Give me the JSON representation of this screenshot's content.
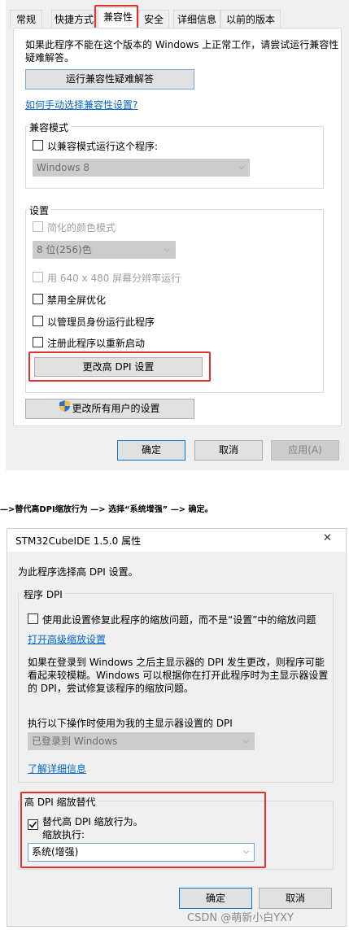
{
  "dialog1": {
    "tabs": [
      "常规",
      "快捷方式",
      "兼容性",
      "安全",
      "详细信息",
      "以前的版本"
    ],
    "intro": "如果此程序不能在这个版本的 Windows 上正常工作，请尝试运行兼容性疑难解答。",
    "intro_line1": "如果此程序不能在这个版本的 Windows 上正常工作，请尝试运行兼容性",
    "intro_line2": "疑难解答。",
    "troubleshooter_button": "运行兼容性疑难解答",
    "manual_link": "如何手动选择兼容性设置?",
    "compat_mode": {
      "group_label": "兼容模式",
      "checkbox_label": "以兼容模式运行这个程序:",
      "os_select": "Windows 8"
    },
    "settings": {
      "group_label": "设置",
      "reduced_color": "简化的颜色模式",
      "color_select": "8 位(256)色",
      "run_640": "用 640 x 480 屏幕分辨率运行",
      "disable_fullscreen": "禁用全屏优化",
      "run_as_admin": "以管理员身份运行此程序",
      "register_restart": "注册此程序以重新启动",
      "change_dpi_button": "更改高 DPI 设置"
    },
    "all_users_button": "更改所有用户的设置",
    "ok": "确定",
    "cancel": "取消",
    "apply": "应用(A)"
  },
  "instruction": "—>替代高DPI缩放行为 —> 选择“系统增强” —> 确定。",
  "dialog2": {
    "title": "STM32CubeIDE 1.5.0 属性",
    "close_glyph": "✕",
    "heading": "为此程序选择高 DPI 设置。",
    "program_dpi": {
      "group_label": "程序 DPI",
      "checkbox_label": "使用此设置修复此程序的缩放问题，而不是“设置”中的缩放问题",
      "advanced_link": "打开高级缩放设置",
      "desc_line1": "如果在登录到 Windows 之后主显示器的 DPI 发生更改，则程序可能",
      "desc_line2": "看起来较模糊。Windows 可以根据你在打开此程序时为主显示器设置",
      "desc_line3": "的 DPI，尝试修复该程序的缩放问题。",
      "when_label": "执行以下操作时使用为我的主显示器设置的 DPI",
      "when_select": "已登录到 Windows",
      "learn_more_link": "了解详细信息"
    },
    "override": {
      "group_label": "高 DPI 缩放替代",
      "checkbox_label": "替代高 DPI 缩放行为。",
      "sub_label": "缩放执行:",
      "select": "系统(增强)"
    },
    "ok": "确定",
    "cancel": "取消"
  },
  "watermark": "CSDN @萌新小白YXY"
}
